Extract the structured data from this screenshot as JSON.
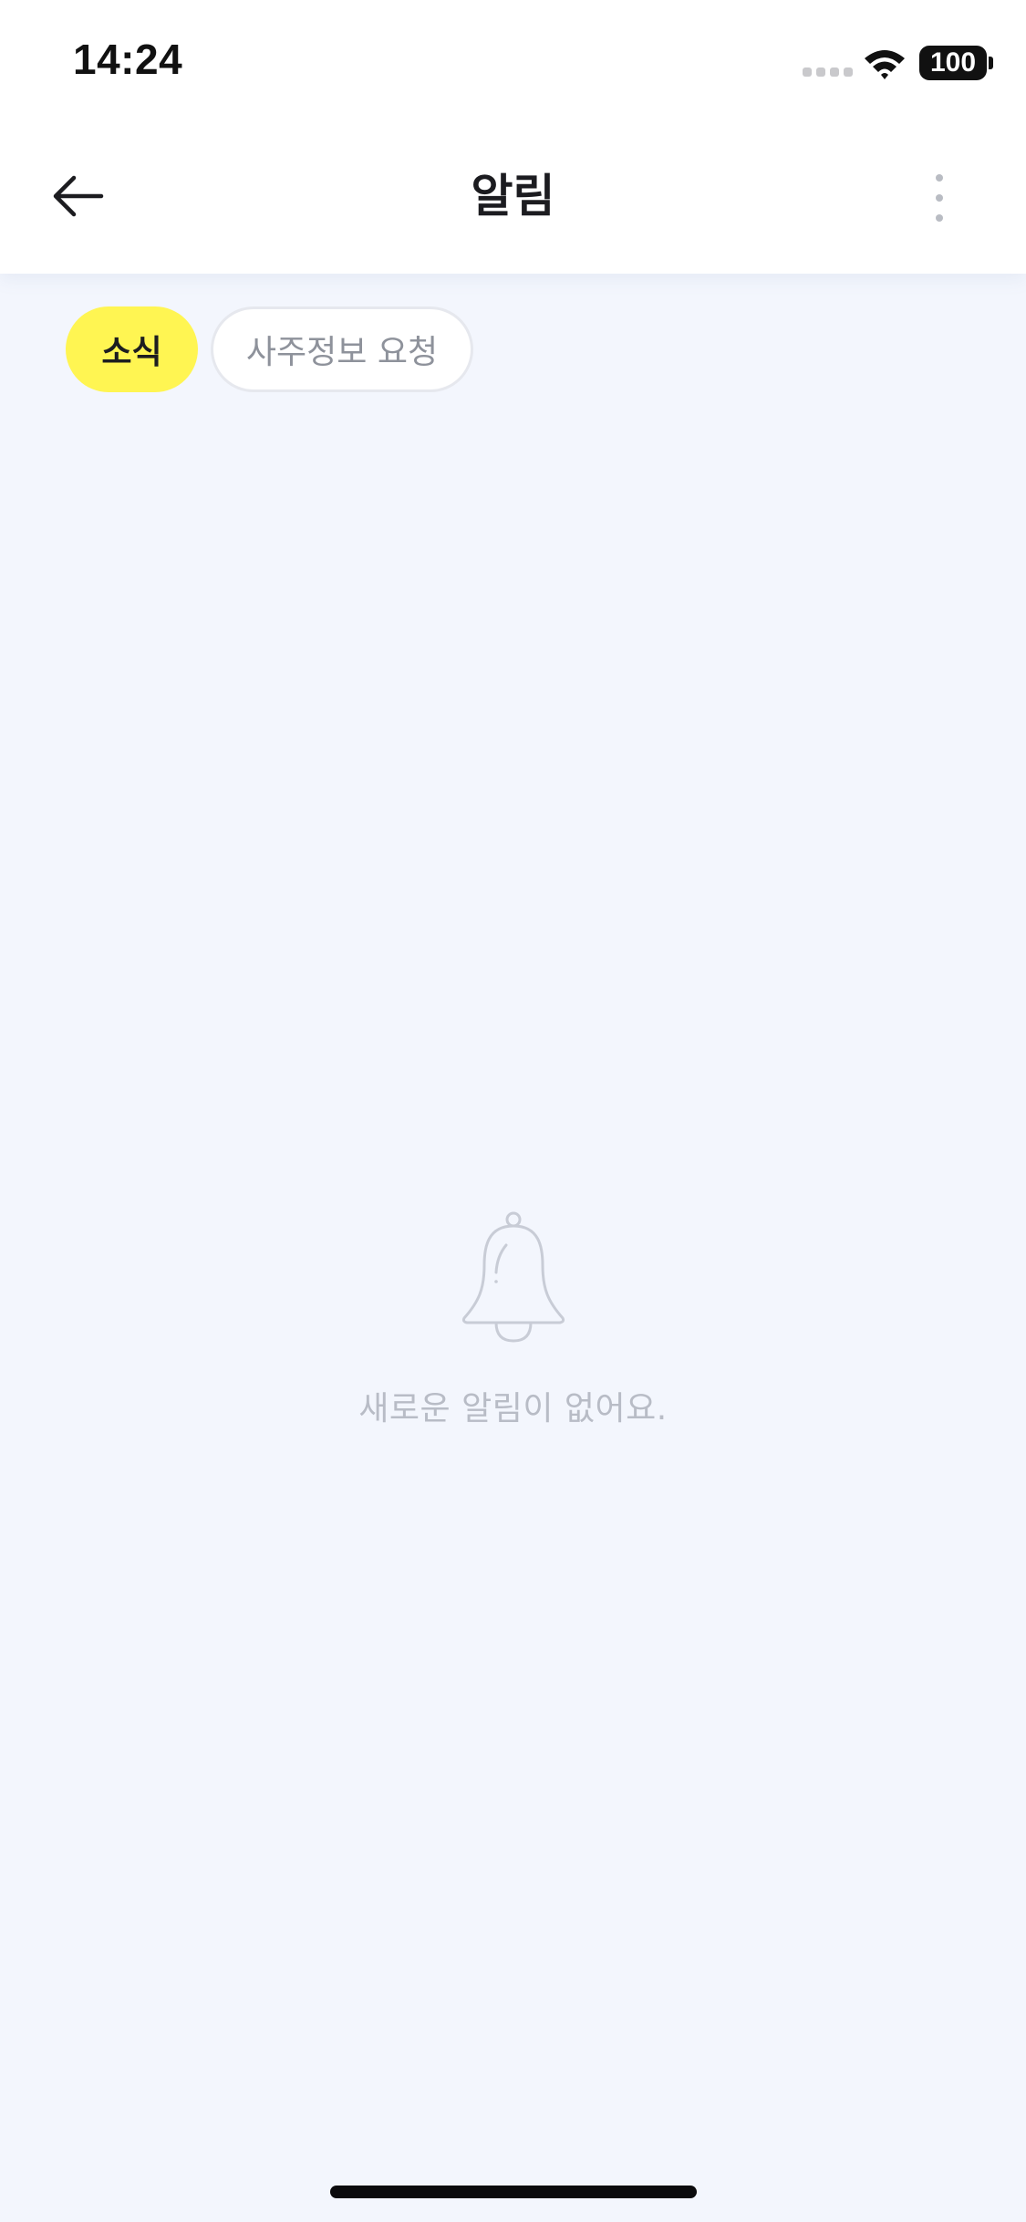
{
  "status_bar": {
    "time": "14:24",
    "battery": "100"
  },
  "header": {
    "title": "알림",
    "back_icon": "arrow-left-icon",
    "more_icon": "more-vertical-icon"
  },
  "tabs": [
    {
      "label": "소식",
      "active": true
    },
    {
      "label": "사주정보 요청",
      "active": false
    }
  ],
  "empty_state": {
    "icon": "bell-icon",
    "message": "새로운 알림이 없어요."
  },
  "colors": {
    "background": "#F3F6FD",
    "accent": "#FFF552",
    "muted_text": "#B8BCC6"
  }
}
